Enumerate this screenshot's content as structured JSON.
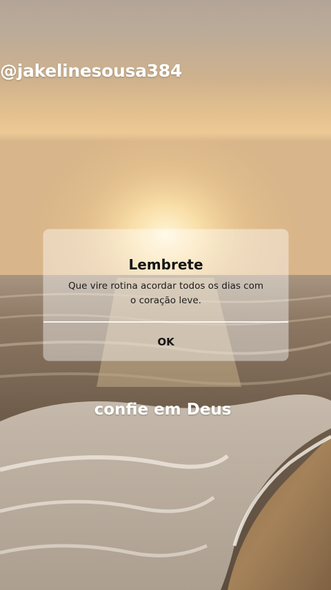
{
  "overlay": {
    "username": "@jakelinesousa384",
    "caption": "confie em Deus"
  },
  "dialog": {
    "title": "Lembrete",
    "message": "Que vire rotina acordar todos os dias com o coração leve.",
    "ok_label": "OK"
  },
  "background": {
    "scene": "sunset beach with waves",
    "sky_color": "#c9aa86",
    "sun_color": "#ffe6b0",
    "sand_color": "#9a7a55"
  }
}
